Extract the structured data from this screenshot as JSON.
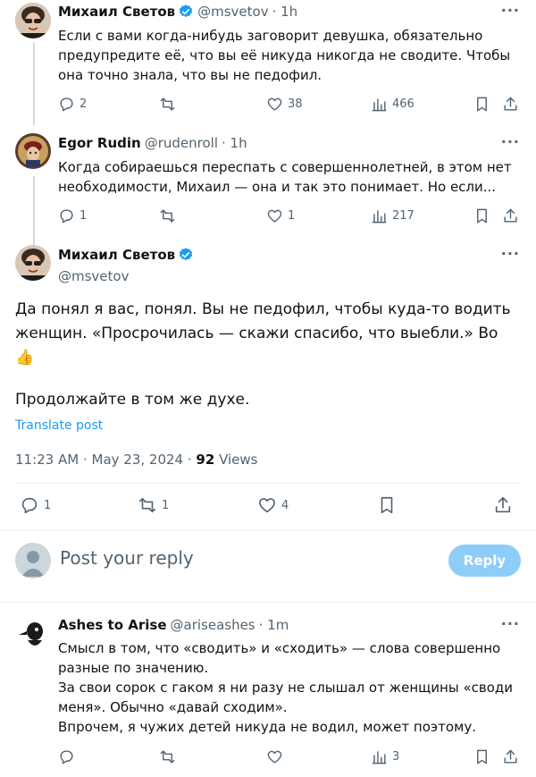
{
  "colors": {
    "accent": "#1d9bf0",
    "verified": "#1d9bf0",
    "muted": "#536471",
    "reply_button_bg": "#8ecdf8"
  },
  "tweets": [
    {
      "name": "Михаил Светов",
      "verified": true,
      "handle": "@msvetov",
      "time": "· 1h",
      "text_lines": [
        "Если с вами когда-нибудь заговорит девушка, обязательно",
        "предупредите её, что вы её никуда никогда не сводите. Чтобы",
        "она точно знала, что вы не педофил."
      ],
      "replies": "2",
      "retweets": "",
      "likes": "38",
      "views": "466"
    },
    {
      "name": "Egor Rudin",
      "verified": false,
      "handle": "@rudenroll",
      "time": "· 1h",
      "text_lines": [
        "Когда собираешься переспать с совершеннолетней, в этом нет",
        "необходимости, Михаил — она и так это понимает. Но если..."
      ],
      "replies": "1",
      "retweets": "",
      "likes": "1",
      "views": "217"
    }
  ],
  "main_tweet": {
    "name": "Михаил Светов",
    "verified": true,
    "handle": "@msvetov",
    "text_line1": "Да понял я вас, понял. Вы не педофил, чтобы куда-то водить",
    "text_line2": "женщин. «Просрочилась — скажи спасибо, что выебли.» Во",
    "emoji": "👍",
    "text_line4": "Продолжайте в том же духе.",
    "translate": "Translate post",
    "time": "11:23 AM · May 23, 2024 ·",
    "views_count": "92",
    "views_label": "Views",
    "replies": "1",
    "retweets": "1",
    "likes": "4"
  },
  "composer": {
    "placeholder": "Post your reply",
    "button": "Reply"
  },
  "reply": {
    "name": "Ashes to Arise",
    "handle": "@ariseashes",
    "time": "· 1m",
    "text_lines": [
      "Смысл в том, что «сводить» и «сходить» — слова совершенно",
      "разные по значению.",
      "За свои сорок с гаком я ни разу не слышал от женщины «своди",
      "меня». Обычно «давай сходим».",
      "Впрочем, я чужих детей никуда не водил, может поэтому."
    ],
    "replies": "",
    "retweets": "",
    "likes": "",
    "views": "3"
  }
}
